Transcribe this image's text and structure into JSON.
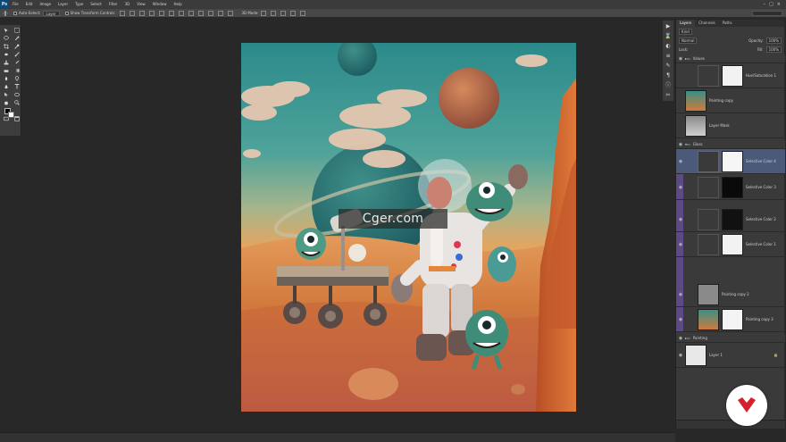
{
  "menubar": {
    "logo": "Ps",
    "items": [
      "File",
      "Edit",
      "Image",
      "Layer",
      "Type",
      "Select",
      "Filter",
      "3D",
      "View",
      "Window",
      "Help"
    ],
    "controls": [
      "–",
      "□",
      "×"
    ]
  },
  "options": {
    "auto_select_label": "Auto-Select:",
    "auto_select_value": "Layer",
    "show_transform_label": "Show Transform Controls",
    "mode_label": "3D Mode:"
  },
  "watermark": {
    "text": "Cger.com"
  },
  "layers_panel": {
    "tabs": [
      "Layers",
      "Channels",
      "Paths"
    ],
    "kind_label": "Kind",
    "blend_mode": "Normal",
    "opacity_label": "Opacity:",
    "opacity_value": "100%",
    "lock_label": "Lock:",
    "fill_label": "Fill:",
    "fill_value": "100%",
    "layers": [
      {
        "name": "Values",
        "type": "group"
      },
      {
        "name": "Hue/Saturation 1",
        "type": "adjustment"
      },
      {
        "name": "Painting copy",
        "type": "image"
      },
      {
        "name": "Layer Mask",
        "type": "image"
      },
      {
        "name": "Gloss",
        "type": "group"
      },
      {
        "name": "Selective Color 4",
        "type": "adjustment"
      },
      {
        "name": "Selective Color 3",
        "type": "adjustment"
      },
      {
        "name": "Selective Color 2",
        "type": "adjustment"
      },
      {
        "name": "Selective Color 1",
        "type": "adjustment"
      },
      {
        "name": "Painting copy 2",
        "type": "image"
      },
      {
        "name": "Painting copy 3",
        "type": "image"
      },
      {
        "name": "Painting",
        "type": "group"
      },
      {
        "name": "Layer 1",
        "type": "image"
      }
    ]
  },
  "colors": {
    "accent_purple": "#5c4a86",
    "selected_layer": "#4c5a7a",
    "badge_red": "#d6202e"
  }
}
